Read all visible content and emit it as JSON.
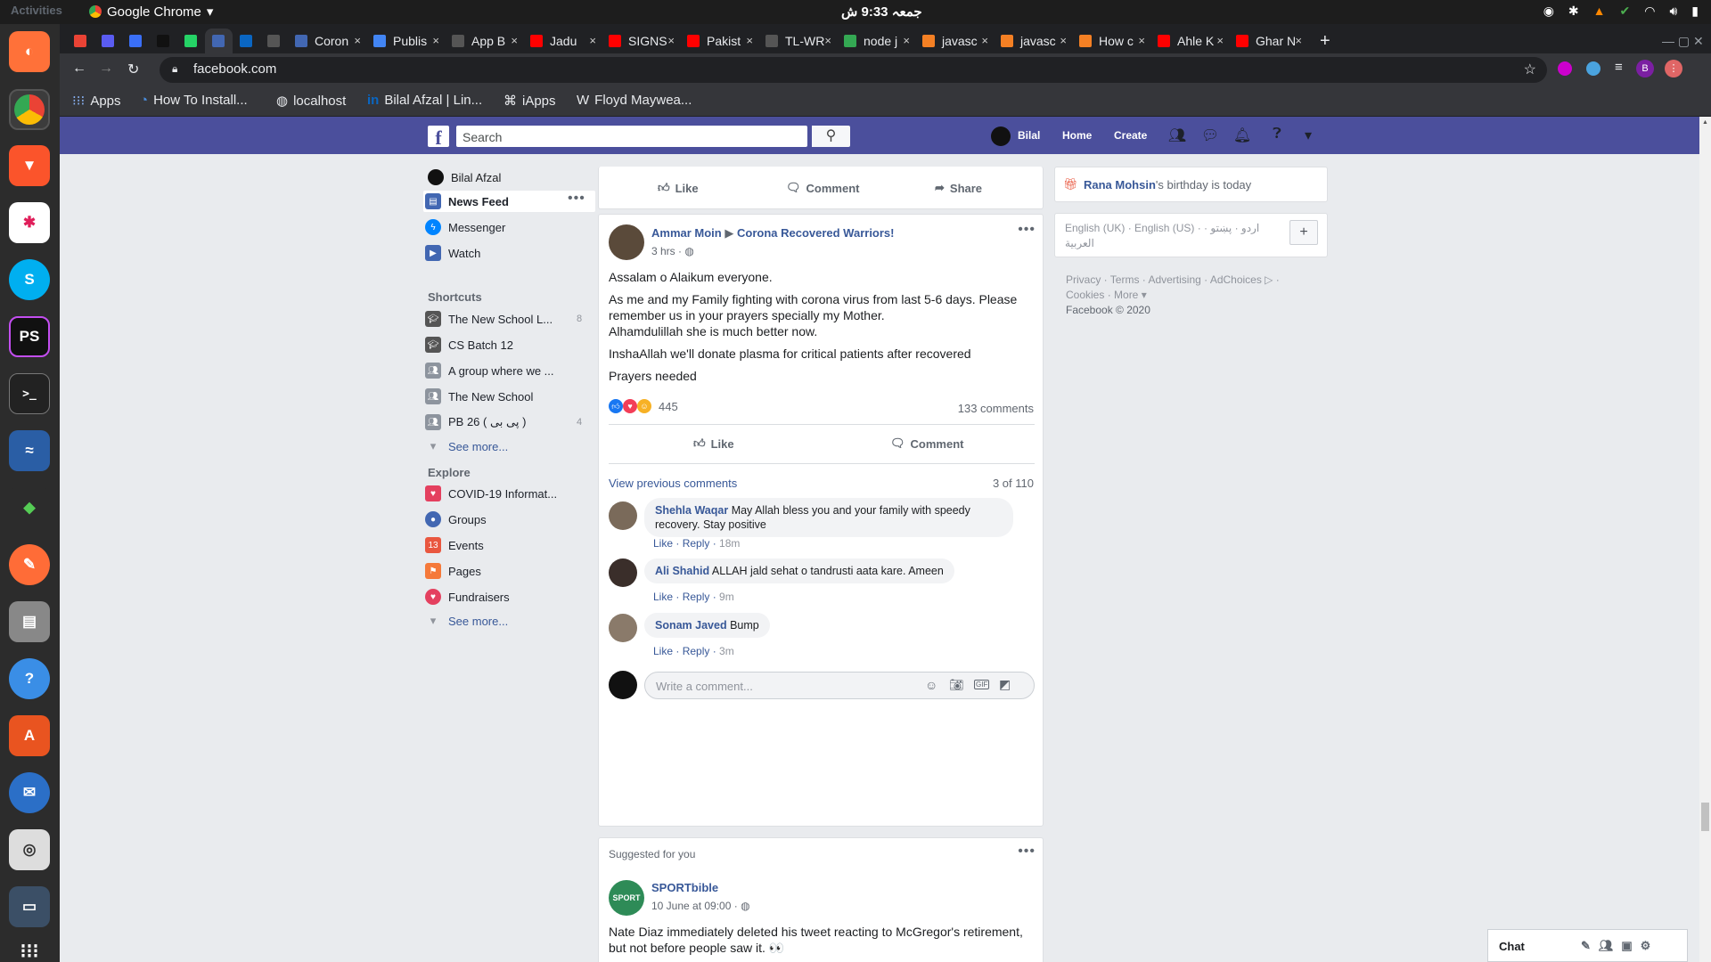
{
  "os": {
    "activities": "Activities",
    "app_name": "Google Chrome",
    "clock": "جمعہ 9:33 ش"
  },
  "tabs": [
    {
      "label": "",
      "color": "#ea4335"
    },
    {
      "label": "",
      "color": "#5a5cf2"
    },
    {
      "label": "",
      "color": "#3a6ff7"
    },
    {
      "label": "",
      "color": "#111111"
    },
    {
      "label": "",
      "color": "#25d366"
    },
    {
      "label": "",
      "color": "#4267b2",
      "active": true
    },
    {
      "label": "",
      "color": "#0a66c2"
    },
    {
      "label": "",
      "color": "#555555"
    },
    {
      "label": "Coron",
      "color": "#4267b2"
    },
    {
      "label": "Publis",
      "color": "#4285f4"
    },
    {
      "label": "App B",
      "color": "#555555"
    },
    {
      "label": "Jadu",
      "color": "#ff0000"
    },
    {
      "label": "SIGNS",
      "color": "#ff0000"
    },
    {
      "label": "Pakist",
      "color": "#ff0000"
    },
    {
      "label": "TL-WR",
      "color": "#555555"
    },
    {
      "label": "node j",
      "color": "#34a853"
    },
    {
      "label": "javasc",
      "color": "#f48024"
    },
    {
      "label": "javasc",
      "color": "#f48024"
    },
    {
      "label": "How c",
      "color": "#f48024"
    },
    {
      "label": "Ahle K",
      "color": "#ff0000"
    },
    {
      "label": "Ghar N",
      "color": "#ff0000"
    }
  ],
  "url": "facebook.com",
  "bookmarks": [
    "Apps",
    "How To Install...",
    "localhost",
    "Bilal Afzal | Lin...",
    "iApps",
    "Floyd Maywea..."
  ],
  "fb": {
    "search_placeholder": "Search",
    "nav": {
      "user": "Bilal",
      "home": "Home",
      "create": "Create"
    },
    "left": {
      "profile": "Bilal Afzal",
      "main": [
        {
          "label": "News Feed",
          "color": "#4267b2"
        },
        {
          "label": "Messenger",
          "color": "#0084ff"
        },
        {
          "label": "Watch",
          "color": "#4267b2"
        }
      ],
      "shortcuts_title": "Shortcuts",
      "shortcuts": [
        {
          "label": "The New School L...",
          "count": "8"
        },
        {
          "label": "CS Batch 12",
          "count": ""
        },
        {
          "label": "A group where we ...",
          "count": ""
        },
        {
          "label": "The New School",
          "count": ""
        },
        {
          "label": "PB 26 ( پی بی )",
          "count": "4"
        }
      ],
      "see_more": "See more...",
      "explore_title": "Explore",
      "explore": [
        {
          "label": "COVID-19 Informat...",
          "color": "#e4405f"
        },
        {
          "label": "Groups",
          "color": "#4267b2"
        },
        {
          "label": "Events",
          "color": "#e9573f"
        },
        {
          "label": "Pages",
          "color": "#f5793a"
        },
        {
          "label": "Fundraisers",
          "color": "#e4405f"
        }
      ],
      "see_more2": "See more..."
    },
    "top_actions": {
      "like": "Like",
      "comment": "Comment",
      "share": "Share"
    },
    "post": {
      "author": "Ammar Moin",
      "group": "Corona Recovered Warriors!",
      "time": "3 hrs ·",
      "p1": "Assalam o Alaikum everyone.",
      "p2": "As me and my Family fighting with corona virus from last 5-6 days. Please remember us in your prayers specially my Mother.",
      "p3": "Alhamdulillah she is much better now.",
      "p4": "InshaAllah we'll donate plasma for critical patients after recovered",
      "p5": "Prayers needed",
      "reactions": "445",
      "comments_count": "133 comments",
      "like": "Like",
      "comment": "Comment",
      "view_prev": "View previous comments",
      "pager": "3 of 110",
      "comments": [
        {
          "name": "Shehla Waqar",
          "text": "May Allah bless you and your family with speedy recovery. Stay positive",
          "like": "Like",
          "reply": "Reply",
          "time": "18m"
        },
        {
          "name": "Ali Shahid",
          "text": "ALLAH jald sehat o tandrusti aata kare. Ameen",
          "like": "Like",
          "reply": "Reply",
          "time": "9m"
        },
        {
          "name": "Sonam Javed",
          "text": "Bump",
          "like": "Like",
          "reply": "Reply",
          "time": "3m"
        }
      ],
      "write_placeholder": "Write a comment..."
    },
    "suggested": {
      "header": "Suggested for you",
      "page": "SPORTbible",
      "time": "10 June at 09:00 ·",
      "text": "Nate Diaz immediately deleted his tweet reacting to McGregor's retirement, but not before people saw it. 👀"
    },
    "right": {
      "birthday_name": "Rana Mohsin",
      "birthday_rest": "'s birthday is today",
      "langs": "English (UK) · English (US) · اردو · پښتو · العربية",
      "footer1": "Privacy · Terms · Advertising · AdChoices ▷ ·",
      "footer2": "Cookies · More ▾",
      "footer3": "Facebook © 2020"
    },
    "chat": "Chat"
  }
}
